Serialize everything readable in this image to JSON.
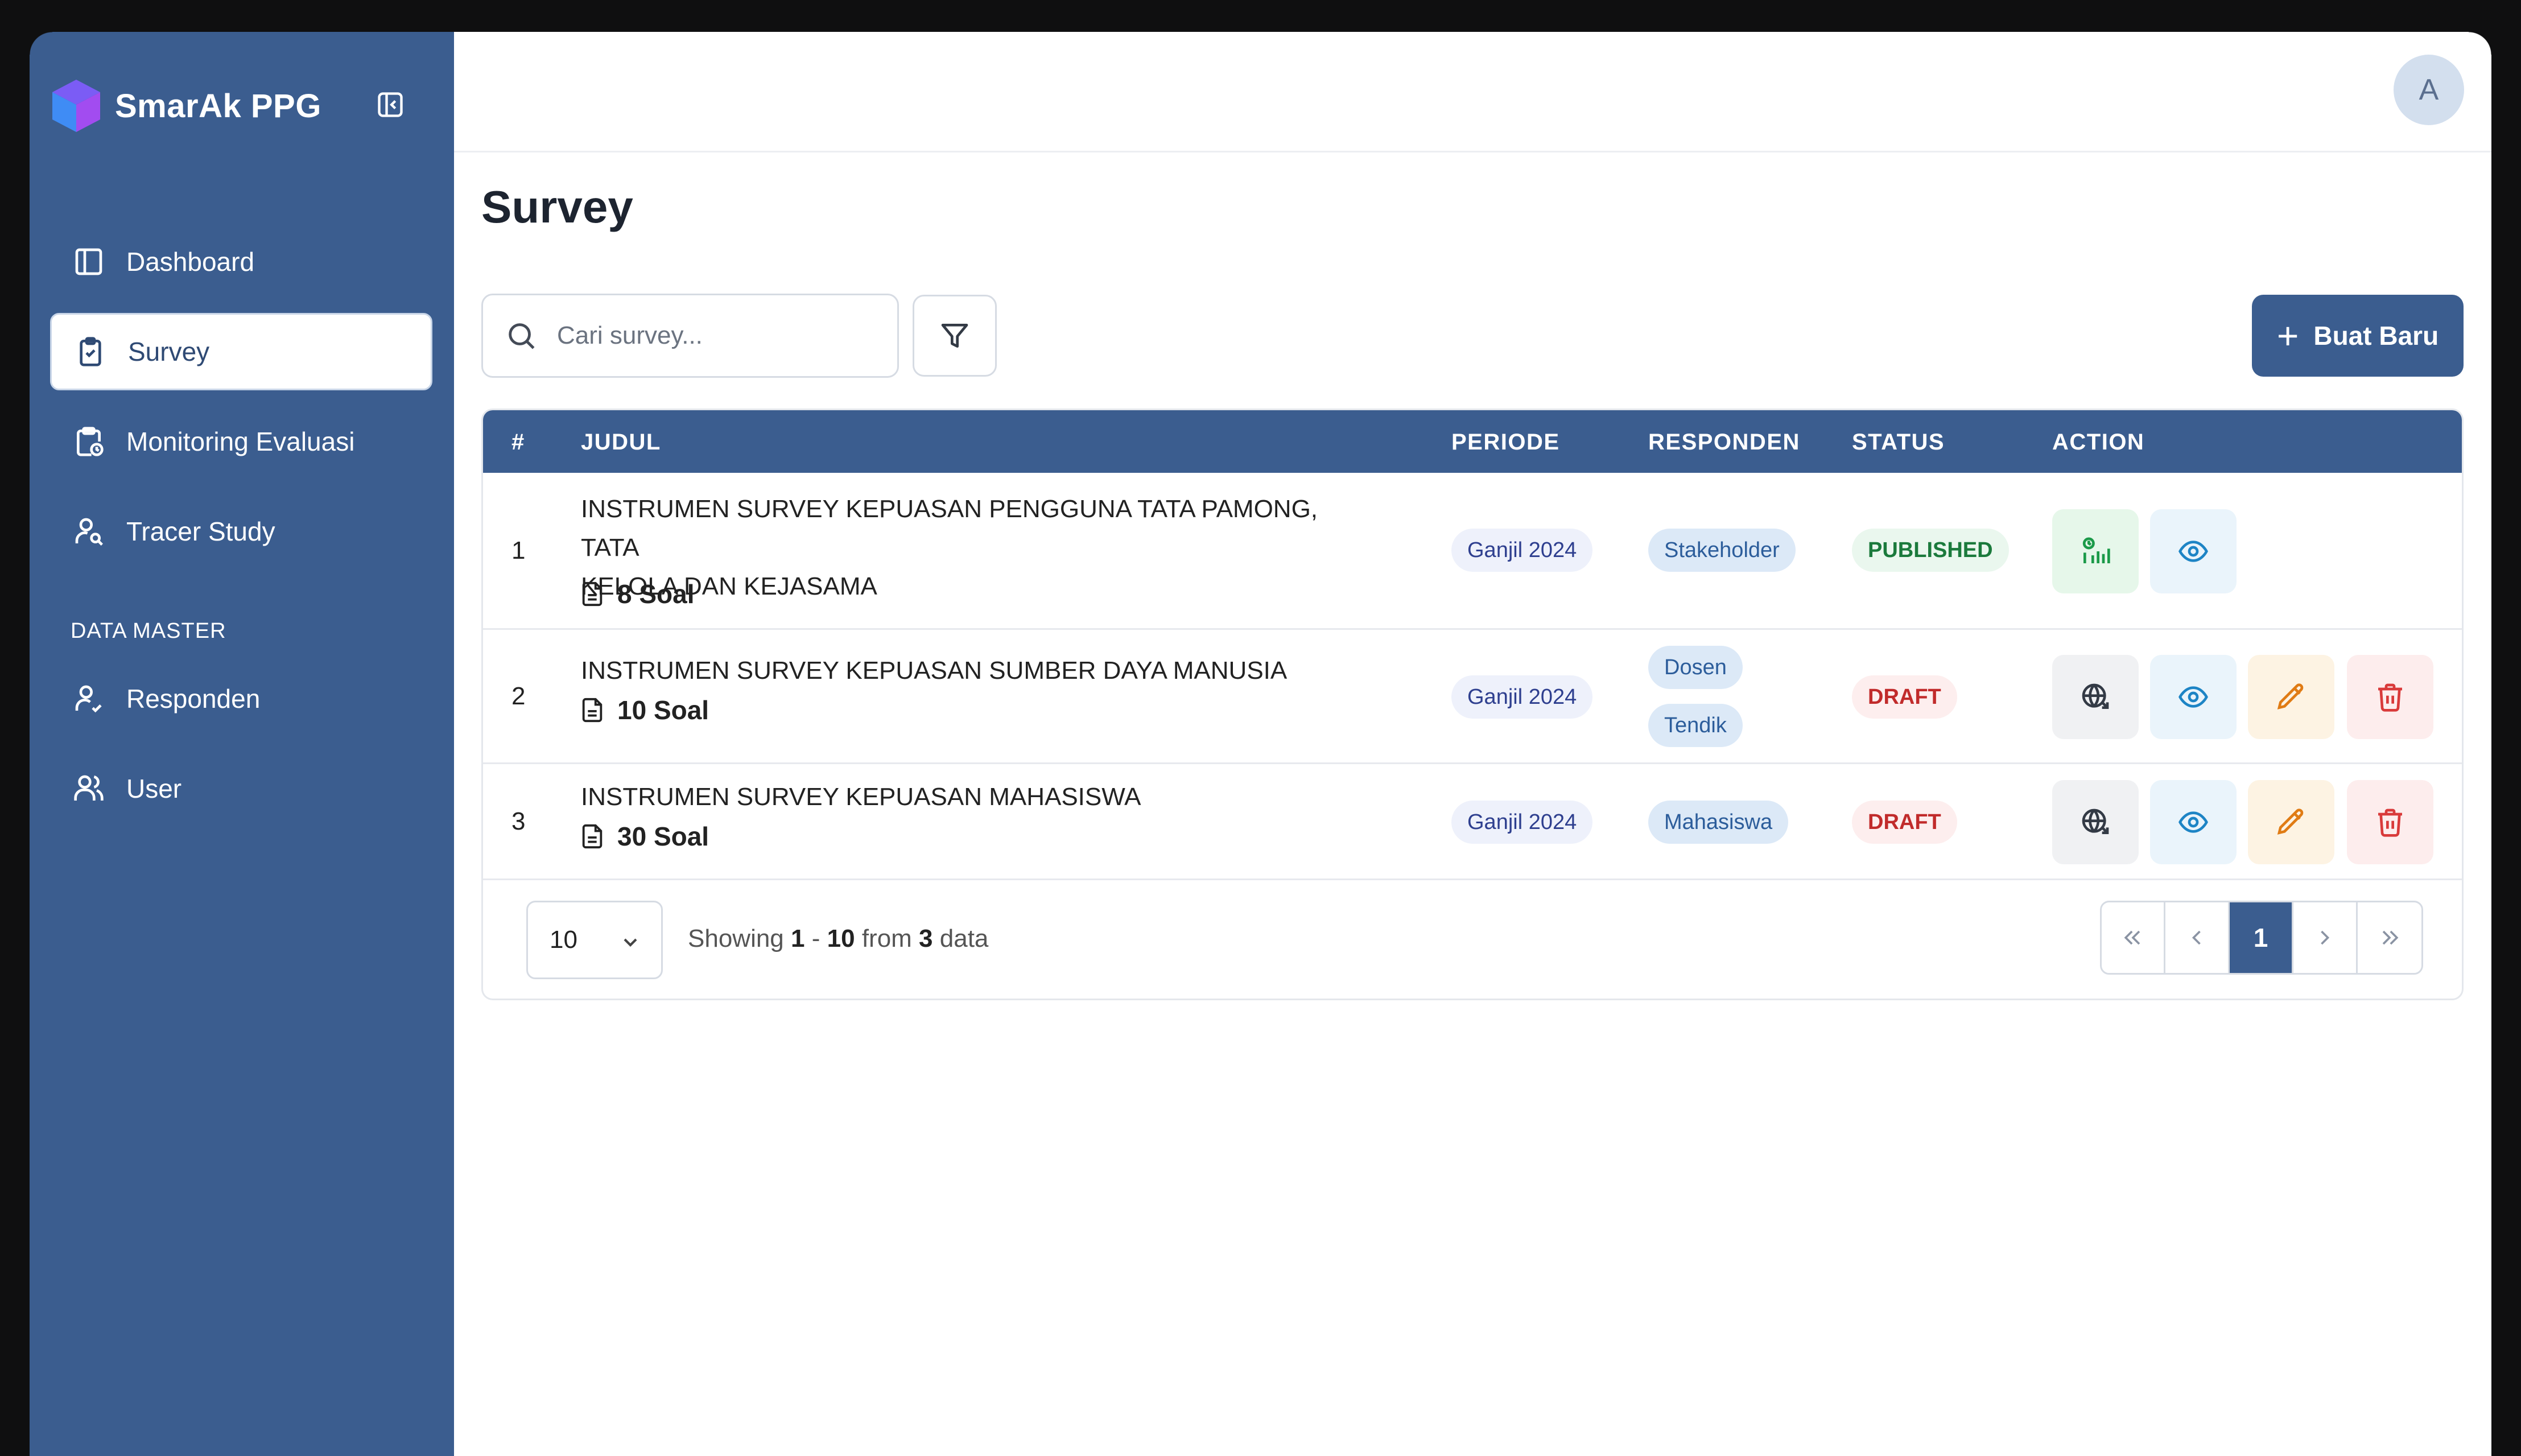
{
  "brand": {
    "name": "SmarAk PPG"
  },
  "sidebar": {
    "items": [
      {
        "label": "Dashboard",
        "icon": "dashboard-icon",
        "active": false
      },
      {
        "label": "Survey",
        "icon": "clipboard-check-icon",
        "active": true
      },
      {
        "label": "Monitoring Evaluasi",
        "icon": "clipboard-clock-icon",
        "active": false
      },
      {
        "label": "Tracer Study",
        "icon": "user-search-icon",
        "active": false
      }
    ],
    "section_label": "DATA MASTER",
    "master_items": [
      {
        "label": "Responden",
        "icon": "user-check-icon"
      },
      {
        "label": "User",
        "icon": "users-icon"
      }
    ]
  },
  "header": {
    "avatar_letter": "A"
  },
  "page": {
    "title": "Survey",
    "search_placeholder": "Cari survey...",
    "new_button_label": "Buat Baru"
  },
  "table": {
    "headers": {
      "num": "#",
      "judul": "JUDUL",
      "periode": "PERIODE",
      "responden": "RESPONDEN",
      "status": "STATUS",
      "action": "ACTION"
    },
    "rows": [
      {
        "num": "1",
        "title_line1": "INSTRUMEN SURVEY KEPUASAN PENGGUNA TATA PAMONG, TATA",
        "title_line2": "KELOLA DAN KEJASAMA",
        "soal": "8 Soal",
        "periode": "Ganjil 2024",
        "responden": [
          "Stakeholder"
        ],
        "status": "PUBLISHED"
      },
      {
        "num": "2",
        "title_line1": "INSTRUMEN SURVEY KEPUASAN SUMBER DAYA MANUSIA",
        "soal": "10 Soal",
        "periode": "Ganjil 2024",
        "responden": [
          "Dosen",
          "Tendik"
        ],
        "status": "DRAFT"
      },
      {
        "num": "3",
        "title_line1": "INSTRUMEN SURVEY KEPUASAN MAHASISWA",
        "soal": "30 Soal",
        "periode": "Ganjil 2024",
        "responden": [
          "Mahasiswa"
        ],
        "status": "DRAFT"
      }
    ]
  },
  "footer": {
    "per_page": "10",
    "showing_prefix": "Showing",
    "showing_from": "1",
    "showing_sep": "-",
    "showing_to": "10",
    "showing_mid": "from",
    "showing_total": "3",
    "showing_suffix": "data",
    "current_page": "1"
  },
  "colors": {
    "primary": "#3b5d8f",
    "published": "#1b7a3c",
    "draft": "#c12b2b"
  }
}
